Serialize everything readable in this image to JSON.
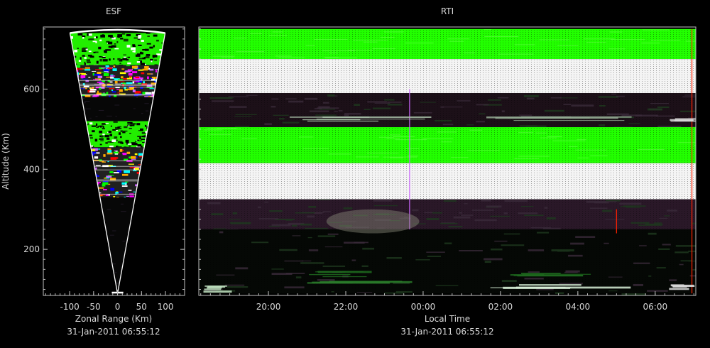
{
  "chart_data": [
    {
      "type": "heatmap",
      "title": "ESF",
      "xlabel": "Zonal Range (Km)",
      "ylabel": "Altitude (Km)",
      "timestamp": "31-Jan-2011 06:55:12",
      "xlim": [
        -155,
        140
      ],
      "ylim": [
        85,
        755
      ],
      "xticks": [
        -100,
        -50,
        0,
        50,
        100
      ],
      "xtick_labels": [
        "-100",
        "-50",
        "0",
        "50",
        "100"
      ],
      "yticks": [
        200,
        400,
        600
      ],
      "ytick_labels": [
        "200",
        "400",
        "600"
      ],
      "fan": {
        "apex_y": 90,
        "half_angle_deg": 8.7,
        "top_y": 740
      },
      "bands": [
        {
          "y0": 640,
          "y1": 740,
          "style": "green-speckle"
        },
        {
          "y0": 580,
          "y1": 660,
          "style": "rainbow"
        },
        {
          "y0": 520,
          "y1": 580,
          "style": "dark"
        },
        {
          "y0": 455,
          "y1": 520,
          "style": "green-speckle"
        },
        {
          "y0": 330,
          "y1": 455,
          "style": "rainbow"
        },
        {
          "y0": 95,
          "y1": 330,
          "style": "dark"
        }
      ]
    },
    {
      "type": "heatmap",
      "title": "RTI",
      "xlabel": "Local Time",
      "ylabel": "",
      "timestamp": "31-Jan-2011 06:55:12",
      "xlim": [
        18.2,
        31.05
      ],
      "ylim": [
        85,
        755
      ],
      "xticks": [
        20,
        22,
        24,
        26,
        28,
        30
      ],
      "xtick_labels": [
        "20:00",
        "22:00",
        "00:00",
        "02:00",
        "04:00",
        "06:00"
      ],
      "bands": [
        {
          "y0": 675,
          "y1": 750,
          "color": "#22ff00"
        },
        {
          "y0": 590,
          "y1": 675,
          "color": "#f4f4f4"
        },
        {
          "y0": 505,
          "y1": 590,
          "color": "#1c1018"
        },
        {
          "y0": 415,
          "y1": 505,
          "color": "#22ff00"
        },
        {
          "y0": 325,
          "y1": 415,
          "color": "#f4f4f4"
        },
        {
          "y0": 250,
          "y1": 325,
          "color": "#2a1828"
        },
        {
          "y0": 90,
          "y1": 250,
          "color": "#050805"
        }
      ],
      "features": [
        {
          "type": "vline",
          "x": 23.65,
          "y0": 250,
          "y1": 600,
          "color": "#cc66ff"
        },
        {
          "type": "vline",
          "x": 30.95,
          "y0": 90,
          "y1": 750,
          "color": "#ff2200"
        },
        {
          "type": "vline",
          "x": 29.0,
          "y0": 240,
          "y1": 300,
          "color": "#ff2200"
        },
        {
          "type": "blob",
          "x": 22.7,
          "y": 270,
          "w": 2.4,
          "h": 60,
          "color": "#8a8a7a"
        },
        {
          "type": "streak",
          "x0": 21.0,
          "x1": 23.5,
          "y": 115,
          "color": "#2a7a2a"
        },
        {
          "type": "streak",
          "x0": 25.5,
          "x1": 29.5,
          "y": 110,
          "color": "#d8f0d8"
        },
        {
          "type": "streak",
          "x0": 18.2,
          "x1": 19.0,
          "y": 103,
          "color": "#c0e0c0"
        },
        {
          "type": "streak",
          "x0": 21.0,
          "x1": 22.5,
          "y": 140,
          "color": "#1e6a1e"
        },
        {
          "type": "streak",
          "x0": 26.0,
          "x1": 28.0,
          "y": 140,
          "color": "#1e6a1e"
        },
        {
          "type": "streak",
          "x0": 20.5,
          "x1": 23.5,
          "y": 525,
          "color": "#a8c0a8"
        },
        {
          "type": "streak",
          "x0": 25.5,
          "x1": 29.0,
          "y": 528,
          "color": "#90a890"
        },
        {
          "type": "streak",
          "x0": 30.3,
          "x1": 31.05,
          "y": 525,
          "color": "#d8d8d8"
        },
        {
          "type": "streak",
          "x0": 30.3,
          "x1": 31.05,
          "y": 110,
          "color": "#d8d8d8"
        }
      ]
    }
  ]
}
